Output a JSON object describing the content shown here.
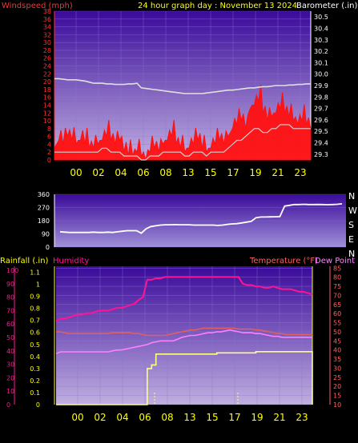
{
  "header": {
    "left_label": "Windspeed (mph)",
    "title": "24 hour graph day : November 13 2024",
    "right_label": "Barometer (.in)"
  },
  "colors": {
    "windspeed": "#ff1010",
    "gust_shadow": "#d0d0d0",
    "barometer": "#e0e0e0",
    "direction": "#ffffff",
    "humidity": "#ff1493",
    "temperature": "#e06060",
    "dewpoint": "#ff80ff",
    "rain": "#ffff80",
    "axis_left": "#ff3030",
    "axis_pink": "#ff1493",
    "axis_yellow": "#ffff00",
    "axis_orange": "#ff6060",
    "bg_top": "#3a0a9a",
    "bg_bottom": "#c0b0e0"
  },
  "chart_data": [
    {
      "type": "line",
      "name": "wind-barometer",
      "x_ticks": [
        "00",
        "02",
        "04",
        "06",
        "08",
        "13",
        "15",
        "17",
        "19",
        "21",
        "23"
      ],
      "y_left": {
        "label": "Windspeed (mph)",
        "ticks": [
          0,
          2,
          4,
          6,
          8,
          10,
          12,
          14,
          16,
          18,
          20,
          22,
          24,
          26,
          28,
          30,
          32,
          34,
          36,
          38
        ]
      },
      "y_right": {
        "label": "Barometer (.in)",
        "ticks": [
          "29.3",
          "29.4",
          "29.5",
          "29.6",
          "29.7",
          "29.8",
          "29.9",
          "30.0",
          "30.1",
          "30.2",
          "30.3",
          "30.4",
          "30.5"
        ]
      },
      "series": [
        {
          "name": "Windspeed",
          "key": "windspeed",
          "style": "spiky",
          "values": [
            3,
            5,
            4,
            6,
            5,
            4,
            5,
            4,
            3,
            3,
            4,
            5,
            6,
            5,
            4,
            5,
            2,
            1,
            1,
            2,
            1,
            0,
            2,
            3,
            2,
            4,
            5,
            6,
            4,
            3,
            2,
            3,
            4,
            5,
            3,
            2,
            3,
            4,
            5,
            4,
            6,
            8,
            9,
            10,
            8,
            13,
            14,
            15,
            12,
            10,
            11,
            12,
            13,
            12,
            11,
            10,
            9,
            10,
            9,
            8
          ]
        },
        {
          "name": "Gust shadow",
          "key": "gust_shadow",
          "style": "line",
          "values": [
            2,
            2,
            2,
            2,
            2,
            2,
            2,
            2,
            2,
            2,
            2,
            3,
            3,
            2,
            2,
            2,
            1,
            1,
            1,
            1,
            0,
            0,
            1,
            1,
            1,
            2,
            2,
            2,
            2,
            2,
            1,
            1,
            2,
            2,
            2,
            1,
            2,
            2,
            2,
            2,
            3,
            4,
            5,
            5,
            6,
            7,
            8,
            8,
            7,
            7,
            8,
            8,
            9,
            9,
            9,
            8,
            8,
            8,
            8,
            8
          ]
        },
        {
          "name": "Barometer",
          "key": "barometer",
          "style": "line",
          "values": [
            29.96,
            29.96,
            29.955,
            29.95,
            29.95,
            29.95,
            29.945,
            29.94,
            29.93,
            29.92,
            29.92,
            29.92,
            29.915,
            29.915,
            29.91,
            29.91,
            29.91,
            29.915,
            29.915,
            29.92,
            29.88,
            29.875,
            29.87,
            29.865,
            29.86,
            29.855,
            29.85,
            29.845,
            29.84,
            29.835,
            29.83,
            29.83,
            29.83,
            29.83,
            29.83,
            29.835,
            29.84,
            29.845,
            29.85,
            29.855,
            29.86,
            29.86,
            29.865,
            29.87,
            29.875,
            29.88,
            29.88,
            29.885,
            29.89,
            29.89,
            29.895,
            29.9,
            29.9,
            29.9,
            29.905,
            29.905,
            29.91,
            29.91,
            29.915,
            29.915
          ]
        }
      ]
    },
    {
      "type": "line",
      "name": "wind-direction",
      "y_left": {
        "ticks": [
          0,
          90,
          180,
          270,
          360
        ]
      },
      "y_right": {
        "ticks": [
          "N",
          "W",
          "S",
          "E",
          "N"
        ]
      },
      "series": [
        {
          "name": "Wind direction",
          "key": "direction",
          "style": "line",
          "values": [
            105,
            102,
            100,
            100,
            100,
            100,
            100,
            102,
            100,
            100,
            102,
            100,
            104,
            108,
            112,
            112,
            112,
            95,
            125,
            140,
            145,
            150,
            152,
            152,
            153,
            152,
            152,
            152,
            150,
            150,
            150,
            150,
            150,
            148,
            150,
            155,
            158,
            160,
            165,
            170,
            175,
            200,
            205,
            205,
            206,
            207,
            208,
            280,
            285,
            290,
            290,
            292,
            290,
            290,
            291,
            290,
            289,
            290,
            292,
            295
          ]
        }
      ]
    },
    {
      "type": "line",
      "name": "rain-humidity-temperature",
      "header": {
        "left1": "Rainfall (.in)",
        "left2": "Humidity",
        "right1": "Temperature (°F)",
        "right2": "Dew Point (°F)"
      },
      "x_ticks": [
        "00",
        "02",
        "04",
        "06",
        "08",
        "13",
        "15",
        "17",
        "19",
        "21",
        "23"
      ],
      "y_rain": {
        "ticks": [
          "0",
          "0.1",
          "0.2",
          "0.3",
          "0.4",
          "0.5",
          "0.6",
          "0.7",
          "0.8",
          "0.9",
          "1",
          "1.1"
        ]
      },
      "y_humidity": {
        "ticks": [
          0,
          10,
          20,
          30,
          40,
          50,
          60,
          70,
          80,
          90,
          100
        ]
      },
      "y_temp": {
        "ticks": [
          10,
          15,
          20,
          25,
          30,
          35,
          40,
          45,
          50,
          55,
          60,
          65,
          70,
          75,
          80,
          85
        ]
      },
      "series": [
        {
          "name": "Humidity",
          "key": "humidity",
          "axis": "humidity",
          "values": [
            62,
            64,
            64,
            65,
            66,
            67,
            67,
            68,
            68,
            69,
            70,
            70,
            70,
            71,
            72,
            72,
            73,
            74,
            75,
            78,
            80,
            93,
            93,
            94,
            94,
            95,
            95,
            95,
            95,
            95,
            95,
            95,
            95,
            95,
            95,
            95,
            95,
            95,
            95,
            95,
            95,
            95,
            95,
            90,
            89,
            89,
            88,
            88,
            87,
            87,
            88,
            87,
            86,
            86,
            86,
            85,
            84,
            84,
            83,
            82
          ]
        },
        {
          "name": "Temperature",
          "key": "temperature",
          "axis": "temp",
          "values": [
            50,
            50,
            49.5,
            49,
            49,
            49,
            49,
            49,
            49,
            49,
            49,
            49,
            49,
            49.5,
            49.5,
            49.5,
            49.5,
            49.5,
            49,
            49,
            48.5,
            48,
            48,
            48,
            48,
            48,
            48.5,
            49,
            49.5,
            50,
            50.5,
            51,
            51,
            51.5,
            52,
            52,
            52,
            52,
            52,
            52,
            52,
            52,
            51.5,
            51.5,
            51.5,
            51.5,
            51,
            51,
            50.5,
            50,
            49.5,
            49,
            49,
            48.5,
            48.5,
            48.5,
            48.5,
            48.5,
            48.5,
            48.5
          ]
        },
        {
          "name": "Dew Point",
          "key": "dewpoint",
          "axis": "temp",
          "values": [
            38,
            39,
            39,
            39,
            39,
            39,
            39,
            39,
            39,
            39,
            39,
            39,
            39,
            39.5,
            40,
            40,
            40.5,
            41,
            41.5,
            42,
            42.5,
            43,
            44,
            44.5,
            45,
            45,
            45,
            45,
            46,
            47,
            47.5,
            48,
            48,
            48.5,
            49,
            49.5,
            49.5,
            50,
            50,
            50.5,
            51,
            50.5,
            50,
            49.5,
            49.5,
            49.5,
            49,
            49,
            48.5,
            48,
            47.5,
            47.5,
            47,
            47,
            47,
            47,
            47,
            47,
            47,
            47
          ]
        },
        {
          "name": "Rainfall",
          "key": "rain",
          "axis": "rain",
          "values": [
            0,
            0,
            0,
            0,
            0,
            0,
            0,
            0,
            0,
            0,
            0,
            0,
            0,
            0,
            0,
            0,
            0,
            0,
            0,
            0,
            0,
            0.3,
            0.33,
            0.42,
            0.42,
            0.42,
            0.42,
            0.42,
            0.42,
            0.42,
            0.42,
            0.42,
            0.42,
            0.42,
            0.42,
            0.42,
            0.42,
            0.43,
            0.43,
            0.43,
            0.43,
            0.43,
            0.43,
            0.43,
            0.43,
            0.43,
            0.44,
            0.44,
            0.44,
            0.44,
            0.44,
            0.44,
            0.44,
            0.44,
            0.44,
            0.44,
            0.44,
            0.44,
            0.44,
            0.0
          ]
        }
      ]
    }
  ]
}
